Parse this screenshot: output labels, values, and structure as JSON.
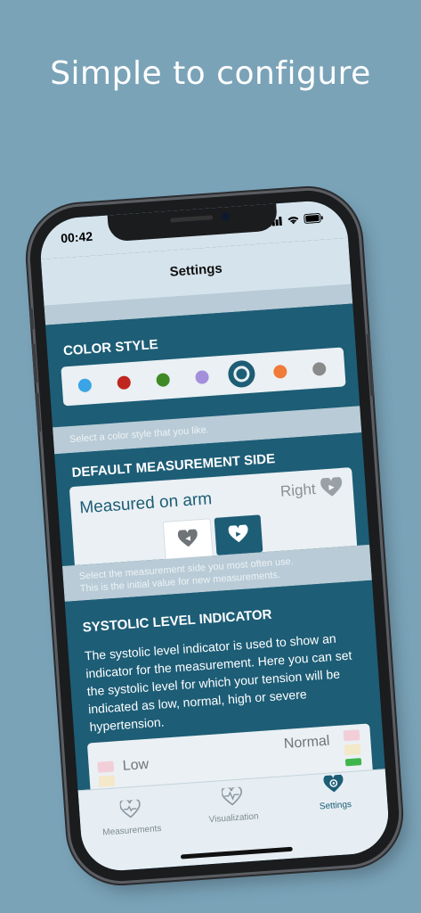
{
  "headline": "Simple to configure",
  "status": {
    "time": "00:42"
  },
  "nav": {
    "title": "Settings"
  },
  "color_style": {
    "header": "COLOR STYLE",
    "colors": [
      "#3aa4e6",
      "#c0251f",
      "#3f8a27",
      "#a48fdb",
      "#1d5d76",
      "#f07a38",
      "#8a8a8a"
    ],
    "selected_index": 4,
    "footer": "Select a color style that you like."
  },
  "measurement_side": {
    "header": "DEFAULT MEASUREMENT SIDE",
    "label": "Measured on arm",
    "value": "Right",
    "footer_line1": "Select the measurement side you most often use.",
    "footer_line2": "This is the initial value for new measurements."
  },
  "systolic": {
    "header": "SYSTOLIC LEVEL INDICATOR",
    "description": "The systolic level indicator is used to show an indicator for the measurement. Here you can set the systolic level for which your tension will be indicated as low, normal, high or severe hypertension.",
    "low_label": "Low",
    "normal_label": "Normal"
  },
  "tabs": [
    {
      "label": "Measurements",
      "icon": "heart-plus-icon"
    },
    {
      "label": "Visualization",
      "icon": "heart-pulse-icon"
    },
    {
      "label": "Settings",
      "icon": "heart-gear-icon"
    }
  ],
  "accent_color": "#1d5d76"
}
